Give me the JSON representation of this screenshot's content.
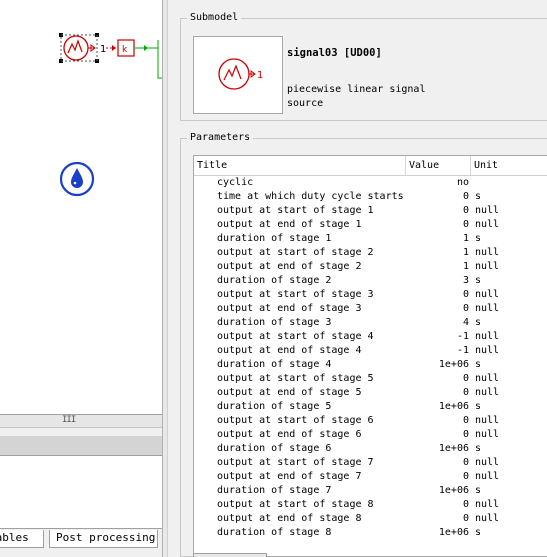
{
  "left_tabs": {
    "variables": "iables",
    "post": "Post processing"
  },
  "splitter_grip": "III",
  "submodel": {
    "legend": "Submodel",
    "name": "signal03 [UD00]",
    "description": "piecewise linear signal source",
    "icon": "signal-source-icon",
    "icon_color": "#cc0000"
  },
  "parameters": {
    "legend": "Parameters",
    "headers": {
      "title": "Title",
      "value": "Value",
      "unit": "Unit"
    },
    "rows": [
      {
        "title": "cyclic",
        "value": "no",
        "unit": ""
      },
      {
        "title": "time at which duty cycle starts",
        "value": "0",
        "unit": "s"
      },
      {
        "title": "output at start of stage 1",
        "value": "0",
        "unit": "null"
      },
      {
        "title": "output at end of stage 1",
        "value": "0",
        "unit": "null"
      },
      {
        "title": "duration of stage 1",
        "value": "1",
        "unit": "s"
      },
      {
        "title": "output at start of stage 2",
        "value": "1",
        "unit": "null"
      },
      {
        "title": "output at end of stage 2",
        "value": "1",
        "unit": "null"
      },
      {
        "title": "duration of stage 2",
        "value": "3",
        "unit": "s"
      },
      {
        "title": "output at start of stage 3",
        "value": "0",
        "unit": "null"
      },
      {
        "title": "output at end of stage 3",
        "value": "0",
        "unit": "null"
      },
      {
        "title": "duration of stage 3",
        "value": "4",
        "unit": "s"
      },
      {
        "title": "output at start of stage 4",
        "value": "-1",
        "unit": "null"
      },
      {
        "title": "output at end of stage 4",
        "value": "-1",
        "unit": "null"
      },
      {
        "title": "duration of stage 4",
        "value": "1e+06",
        "unit": "s"
      },
      {
        "title": "output at start of stage 5",
        "value": "0",
        "unit": "null"
      },
      {
        "title": "output at end of stage 5",
        "value": "0",
        "unit": "null"
      },
      {
        "title": "duration of stage 5",
        "value": "1e+06",
        "unit": "s"
      },
      {
        "title": "output at start of stage 6",
        "value": "0",
        "unit": "null"
      },
      {
        "title": "output at end of stage 6",
        "value": "0",
        "unit": "null"
      },
      {
        "title": "duration of stage 6",
        "value": "1e+06",
        "unit": "s"
      },
      {
        "title": "output at start of stage 7",
        "value": "0",
        "unit": "null"
      },
      {
        "title": "output at end of stage 7",
        "value": "0",
        "unit": "null"
      },
      {
        "title": "duration of stage 7",
        "value": "1e+06",
        "unit": "s"
      },
      {
        "title": "output at start of stage 8",
        "value": "0",
        "unit": "null"
      },
      {
        "title": "output at end of stage 8",
        "value": "0",
        "unit": "null"
      },
      {
        "title": "duration of stage 8",
        "value": "1e+06",
        "unit": "s"
      }
    ]
  },
  "canvas": {
    "gain_label": "k",
    "port_label": "1",
    "signal_color": "#cc0000",
    "link_color": "#00aa00",
    "hydraulic_color": "#1a3fc8"
  }
}
